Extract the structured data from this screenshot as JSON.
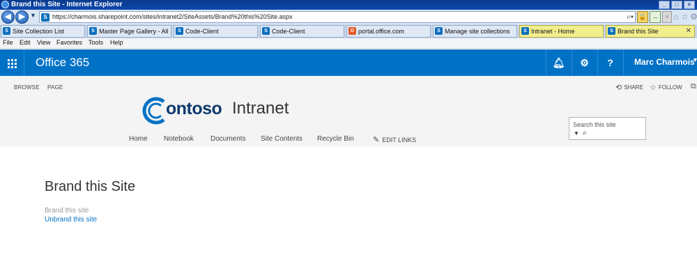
{
  "browser": {
    "title": "Brand this Site - Internet Explorer",
    "url": "https://charmois.sharepoint.com/sites/intranet2/SiteAssets/Brand%20this%20Site.aspx",
    "tabs": [
      {
        "label": "Site Collection List"
      },
      {
        "label": "Master Page Gallery - All ..."
      },
      {
        "label": "Code-Client"
      },
      {
        "label": "Code-Client"
      },
      {
        "label": "portal.office.com"
      },
      {
        "label": "Manage site collections"
      },
      {
        "label": "Intranet - Home"
      },
      {
        "label": "Brand this Site"
      }
    ],
    "menu": [
      "File",
      "Edit",
      "View",
      "Favorites",
      "Tools",
      "Help"
    ]
  },
  "suite": {
    "app_name": "Office 365",
    "user_name": "Marc Charmois"
  },
  "ribbon": {
    "tabs": [
      "BROWSE",
      "PAGE"
    ],
    "share_label": "SHARE",
    "follow_label": "FOLLOW"
  },
  "site": {
    "logo_text": "ontoso",
    "title": "Intranet",
    "nav": [
      "Home",
      "Notebook",
      "Documents",
      "Site Contents",
      "Recycle Bin"
    ],
    "edit_links": "EDIT LINKS",
    "search_placeholder": "Search this site"
  },
  "content": {
    "page_title": "Brand this Site",
    "brand_link": "Brand this site",
    "unbrand_link": "Unbrand this site"
  },
  "colors": {
    "suite_bar": "#0072c6",
    "link": "#0072c6",
    "logo": "#0e3a6e"
  }
}
